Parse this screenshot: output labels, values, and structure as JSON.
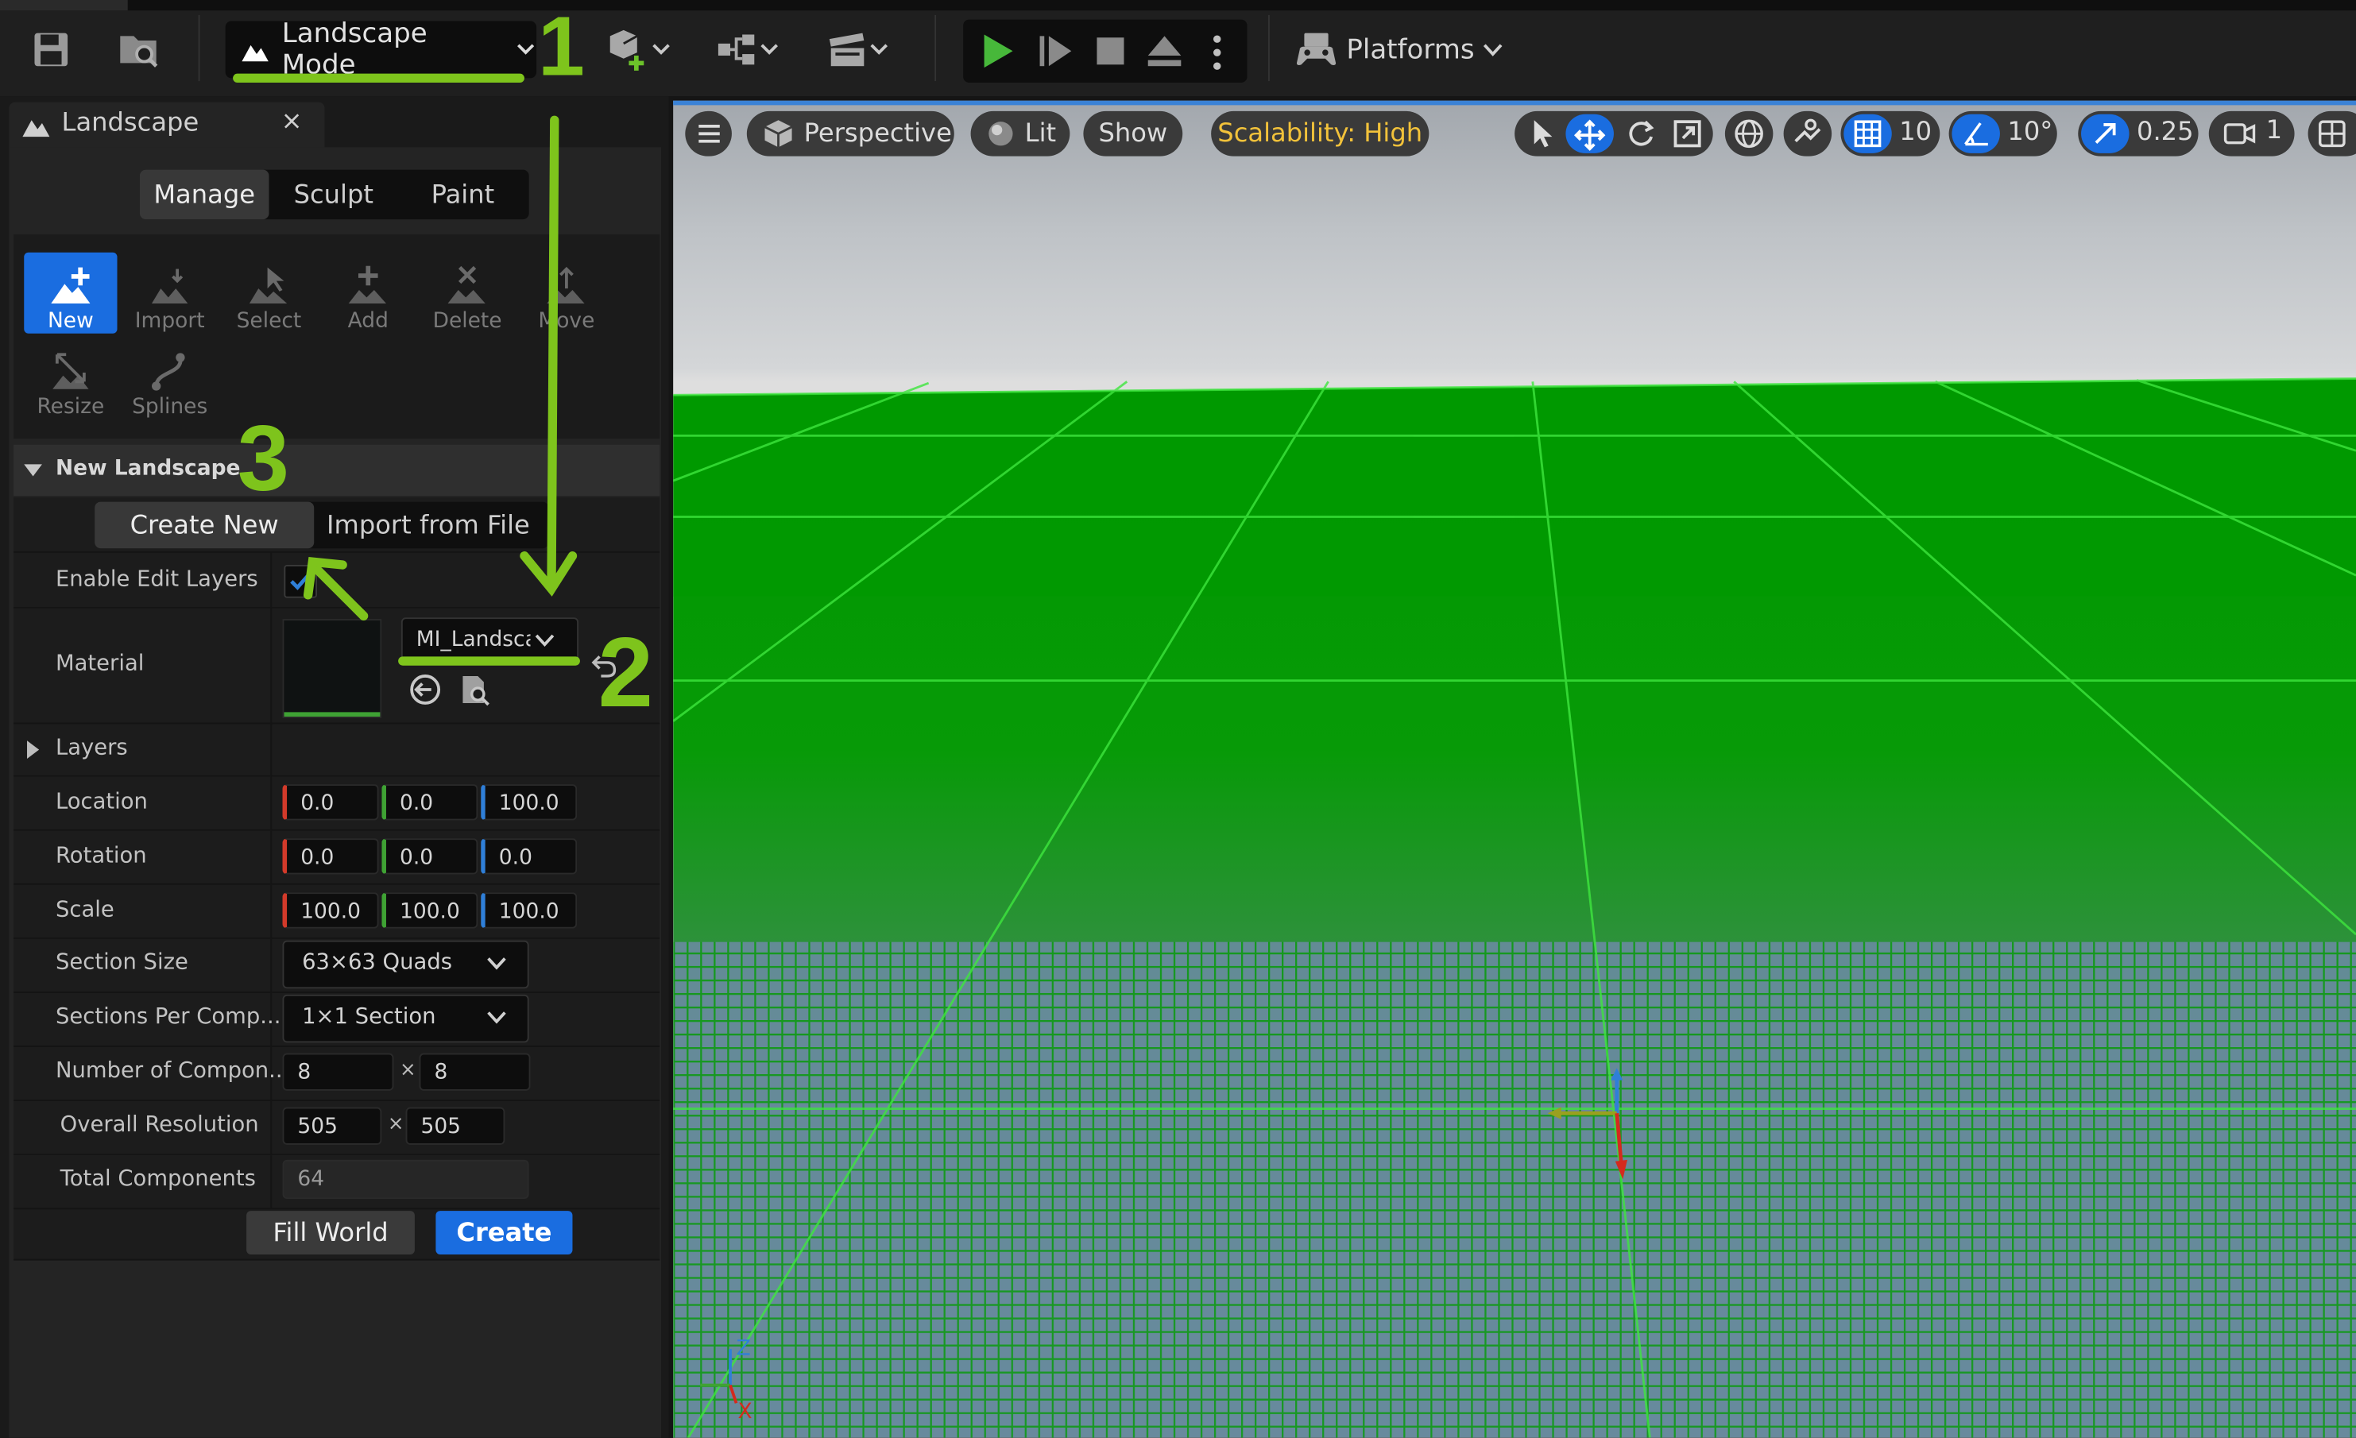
{
  "toolbar": {
    "mode_label": "Landscape Mode",
    "platforms_label": "Platforms"
  },
  "panel": {
    "tab_title": "Landscape",
    "close_glyph": "×",
    "modes": [
      "Manage",
      "Sculpt",
      "Paint"
    ],
    "active_mode": "Manage",
    "tools": [
      {
        "label": "New",
        "icon": "new-landscape-icon",
        "active": true
      },
      {
        "label": "Import",
        "icon": "import-icon",
        "active": false
      },
      {
        "label": "Select",
        "icon": "select-icon",
        "active": false
      },
      {
        "label": "Add",
        "icon": "add-icon",
        "active": false
      },
      {
        "label": "Delete",
        "icon": "delete-icon",
        "active": false
      },
      {
        "label": "Move",
        "icon": "move-icon",
        "active": false
      },
      {
        "label": "Resize",
        "icon": "resize-icon",
        "active": false
      },
      {
        "label": "Splines",
        "icon": "splines-icon",
        "active": false
      }
    ],
    "section_title": "New Landscape",
    "create_modes": [
      "Create New",
      "Import from File"
    ],
    "active_create_mode": "Create New",
    "rows": {
      "enable_edit_layers": {
        "label": "Enable Edit Layers",
        "checked": true
      },
      "material": {
        "label": "Material",
        "value": "MI_Landsca"
      },
      "layers": {
        "label": "Layers"
      },
      "location": {
        "label": "Location",
        "x": "0.0",
        "y": "0.0",
        "z": "100.0"
      },
      "rotation": {
        "label": "Rotation",
        "x": "0.0",
        "y": "0.0",
        "z": "0.0"
      },
      "scale": {
        "label": "Scale",
        "x": "100.0",
        "y": "100.0",
        "z": "100.0"
      },
      "section_size": {
        "label": "Section Size",
        "value": "63×63 Quads"
      },
      "sections_per_component": {
        "label": "Sections Per Comp...",
        "value": "1×1 Section"
      },
      "number_of_components": {
        "label": "Number of Compon...",
        "x": "8",
        "y": "8"
      },
      "overall_resolution": {
        "label": "Overall Resolution",
        "x": "505",
        "y": "505"
      },
      "total_components": {
        "label": "Total Components",
        "value": "64"
      }
    },
    "times_glyph": "×",
    "fill_world_label": "Fill World",
    "create_label": "Create"
  },
  "viewport": {
    "perspective_label": "Perspective",
    "lit_label": "Lit",
    "show_label": "Show",
    "scalability_label": "Scalability: High",
    "grid_snap_value": "10",
    "rotation_snap_value": "10°",
    "scale_snap_value": "0.25",
    "camera_speed_value": "1",
    "axis_labels": {
      "z": "Z",
      "x": "X"
    }
  },
  "annotations": {
    "step1": "1",
    "step2": "2",
    "step3": "3"
  },
  "colors": {
    "accent_blue": "#1a6de0",
    "annotation_green": "#7ec41c",
    "landscape_green": "#009a00",
    "scalability_yellow": "#f2c23a"
  }
}
